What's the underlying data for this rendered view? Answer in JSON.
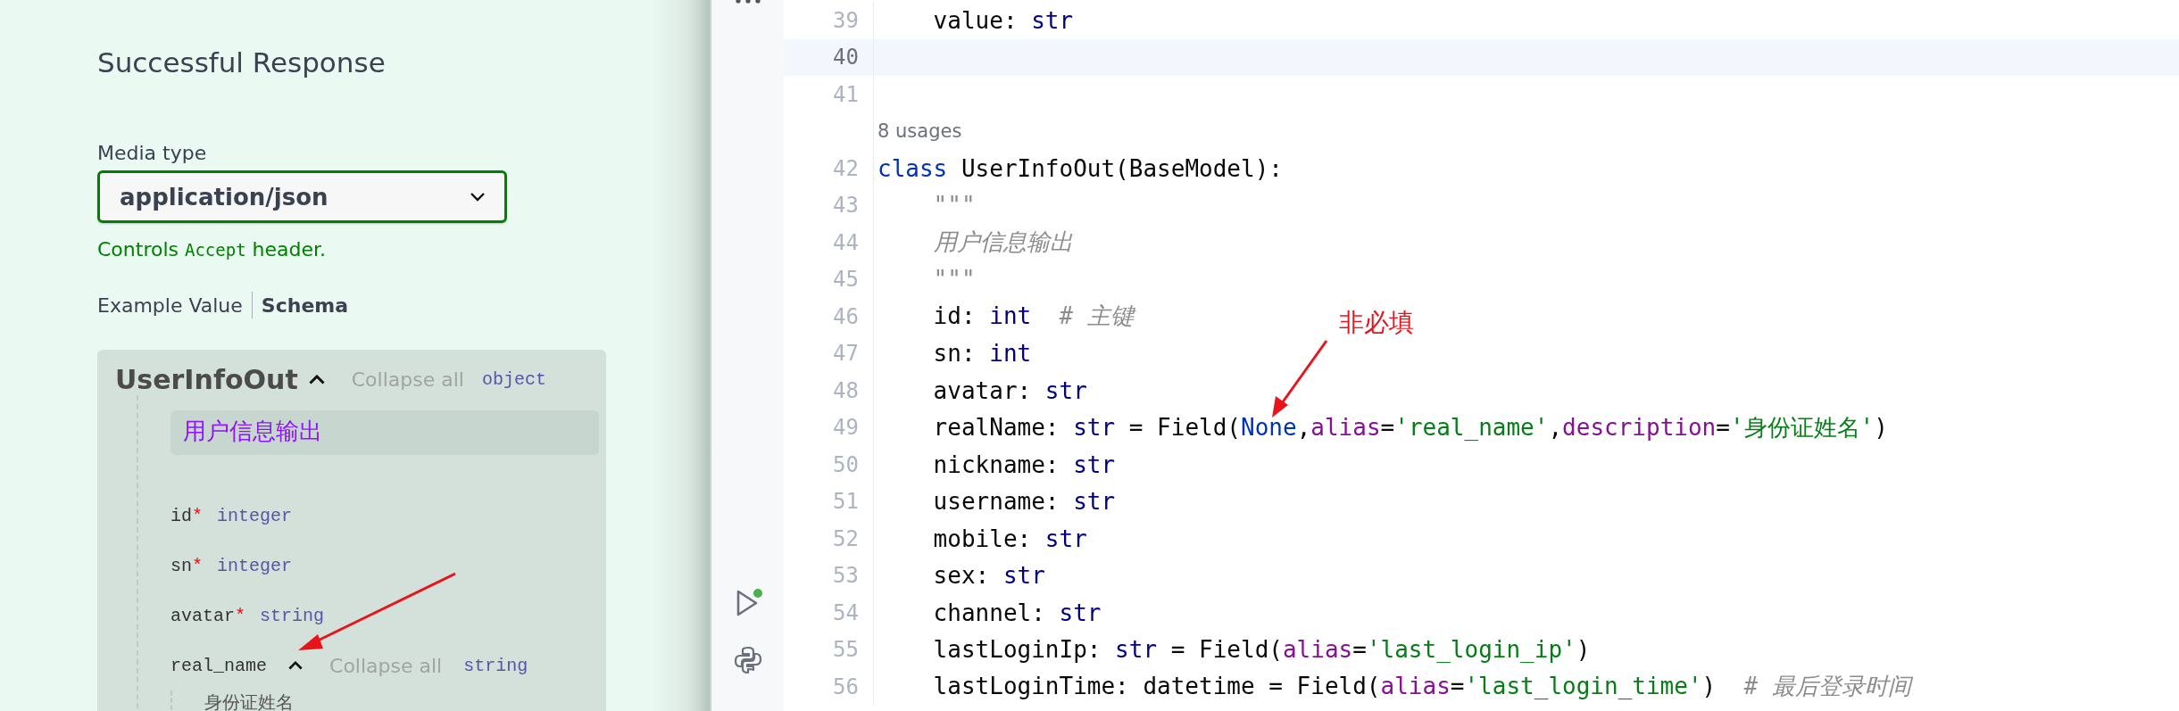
{
  "response": {
    "title": "Successful Response",
    "media_type_label": "Media type",
    "media_type": {
      "value": "application/json"
    },
    "controls_note": {
      "before": "Controls",
      "code": "Accept",
      "after": "header."
    },
    "example_tabs": [
      {
        "label": "Example Value",
        "selected": false
      },
      {
        "label": "Schema",
        "selected": true
      }
    ],
    "schema": {
      "name": "UserInfoOut",
      "collapse": "Collapse all",
      "type": "object",
      "description": "用户信息输出",
      "fields": [
        {
          "kind": "plain",
          "name": "id",
          "required_mark": "*",
          "type": "integer"
        },
        {
          "kind": "plain",
          "name": "sn",
          "required_mark": "*",
          "type": "integer"
        },
        {
          "kind": "plain",
          "name": "avatar",
          "required_mark": "*",
          "type": "string"
        },
        {
          "kind": "nested",
          "name": "real_name",
          "collapse": "Collapse all",
          "type": "string",
          "description": "身份证姓名"
        }
      ]
    }
  },
  "editor": {
    "rows": [
      {
        "kind": "code",
        "number": "39",
        "current": false,
        "tokens": [
          {
            "kind": "plain",
            "t": "    value: "
          },
          {
            "kind": "type",
            "t": "str"
          }
        ]
      },
      {
        "kind": "code",
        "number": "40",
        "current": true,
        "tokens": []
      },
      {
        "kind": "code",
        "number": "41",
        "current": false,
        "tokens": []
      },
      {
        "kind": "hint",
        "text": "8 usages"
      },
      {
        "kind": "code",
        "number": "42",
        "current": false,
        "tokens": [
          {
            "kind": "kw",
            "t": "class "
          },
          {
            "kind": "plain",
            "t": "UserInfoOut(BaseModel):"
          }
        ]
      },
      {
        "kind": "code",
        "number": "43",
        "current": false,
        "tokens": [
          {
            "kind": "doc",
            "t": "    \"\"\""
          }
        ]
      },
      {
        "kind": "code",
        "number": "44",
        "current": false,
        "tokens": [
          {
            "kind": "doc",
            "t": "    用户信息输出"
          }
        ]
      },
      {
        "kind": "code",
        "number": "45",
        "current": false,
        "tokens": [
          {
            "kind": "doc",
            "t": "    \"\"\""
          }
        ]
      },
      {
        "kind": "code",
        "number": "46",
        "current": false,
        "tokens": [
          {
            "kind": "plain",
            "t": "    id: "
          },
          {
            "kind": "type",
            "t": "int"
          },
          {
            "kind": "comment",
            "t": "  # 主键"
          }
        ]
      },
      {
        "kind": "code",
        "number": "47",
        "current": false,
        "tokens": [
          {
            "kind": "plain",
            "t": "    sn: "
          },
          {
            "kind": "type",
            "t": "int"
          }
        ]
      },
      {
        "kind": "code",
        "number": "48",
        "current": false,
        "tokens": [
          {
            "kind": "plain",
            "t": "    avatar: "
          },
          {
            "kind": "type",
            "t": "str"
          }
        ]
      },
      {
        "kind": "code",
        "number": "49",
        "current": false,
        "tokens": [
          {
            "kind": "plain",
            "t": "    realName: "
          },
          {
            "kind": "type",
            "t": "str"
          },
          {
            "kind": "plain",
            "t": " = Field("
          },
          {
            "kind": "kw",
            "t": "None"
          },
          {
            "kind": "plain",
            "t": ","
          },
          {
            "kind": "kwarg",
            "t": "alias"
          },
          {
            "kind": "plain",
            "t": "="
          },
          {
            "kind": "str",
            "t": "'real_name'"
          },
          {
            "kind": "plain",
            "t": ","
          },
          {
            "kind": "kwarg",
            "t": "description"
          },
          {
            "kind": "plain",
            "t": "="
          },
          {
            "kind": "str",
            "t": "'身份证姓名'"
          },
          {
            "kind": "plain",
            "t": ")"
          }
        ]
      },
      {
        "kind": "code",
        "number": "50",
        "current": false,
        "tokens": [
          {
            "kind": "plain",
            "t": "    nickname: "
          },
          {
            "kind": "type",
            "t": "str"
          }
        ]
      },
      {
        "kind": "code",
        "number": "51",
        "current": false,
        "tokens": [
          {
            "kind": "plain",
            "t": "    username: "
          },
          {
            "kind": "type",
            "t": "str"
          }
        ]
      },
      {
        "kind": "code",
        "number": "52",
        "current": false,
        "tokens": [
          {
            "kind": "plain",
            "t": "    mobile: "
          },
          {
            "kind": "type",
            "t": "str"
          }
        ]
      },
      {
        "kind": "code",
        "number": "53",
        "current": false,
        "tokens": [
          {
            "kind": "plain",
            "t": "    sex: "
          },
          {
            "kind": "type",
            "t": "str"
          }
        ]
      },
      {
        "kind": "code",
        "number": "54",
        "current": false,
        "tokens": [
          {
            "kind": "plain",
            "t": "    channel: "
          },
          {
            "kind": "type",
            "t": "str"
          }
        ]
      },
      {
        "kind": "code",
        "number": "55",
        "current": false,
        "tokens": [
          {
            "kind": "plain",
            "t": "    lastLoginIp: "
          },
          {
            "kind": "type",
            "t": "str"
          },
          {
            "kind": "plain",
            "t": " = Field("
          },
          {
            "kind": "kwarg",
            "t": "alias"
          },
          {
            "kind": "plain",
            "t": "="
          },
          {
            "kind": "str",
            "t": "'last_login_ip'"
          },
          {
            "kind": "plain",
            "t": ")"
          }
        ]
      },
      {
        "kind": "code",
        "number": "56",
        "current": false,
        "tokens": [
          {
            "kind": "plain",
            "t": "    lastLoginTime: datetime = Field("
          },
          {
            "kind": "kwarg",
            "t": "alias"
          },
          {
            "kind": "plain",
            "t": "="
          },
          {
            "kind": "str",
            "t": "'last_login_time'"
          },
          {
            "kind": "plain",
            "t": ")"
          },
          {
            "kind": "comment",
            "t": "  # 最后登录时间"
          }
        ]
      }
    ]
  },
  "annotation": {
    "text": "非必填"
  }
}
